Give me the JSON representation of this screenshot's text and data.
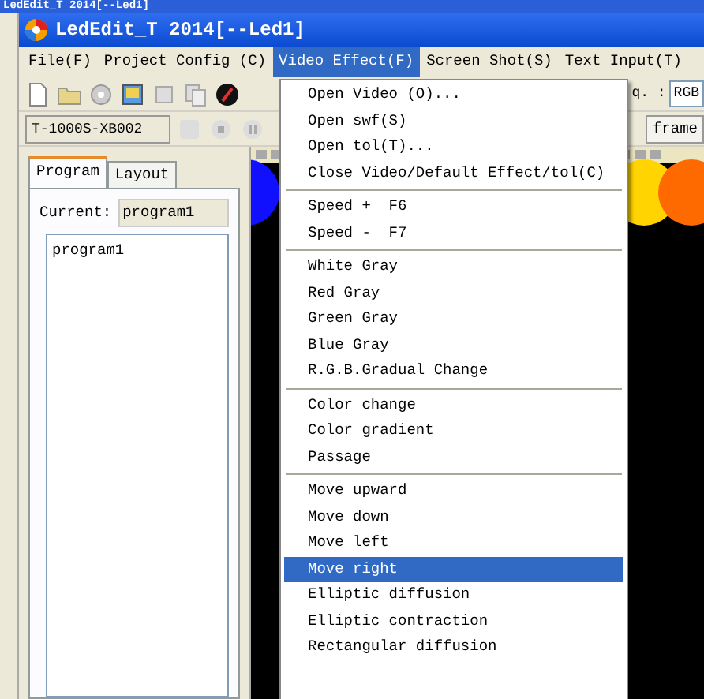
{
  "back_window": {
    "title": "LedEdit_T 2014[--Led1]"
  },
  "window": {
    "title": "LedEdit_T 2014[--Led1]"
  },
  "menu_bar": [
    {
      "label": "File(F)",
      "selected": false
    },
    {
      "label": "Project Config (C)",
      "selected": false
    },
    {
      "label": "Video Effect(F)",
      "selected": true
    },
    {
      "label": "Screen Shot(S)",
      "selected": false
    },
    {
      "label": "Text Input(T)",
      "selected": false
    }
  ],
  "toolbar": {
    "color_label": "q. :",
    "color_value": "RGB",
    "device": "T-1000S-XB002",
    "frame_button": "frame"
  },
  "left_panel": {
    "tabs": [
      {
        "label": "Program",
        "selected": true
      },
      {
        "label": "Layout",
        "selected": false
      }
    ],
    "current_label": "Current:",
    "current_value": "program1",
    "programs": [
      {
        "label": "program1",
        "selected": false
      }
    ]
  },
  "canvas": {
    "circles": [
      {
        "color": "#1010ff"
      },
      {
        "color": "#ffd400"
      },
      {
        "color": "#ff6a00"
      }
    ]
  },
  "dropdown": {
    "groups": [
      [
        {
          "label": "Open Video (O)...",
          "selected": false
        },
        {
          "label": "Open swf(S)",
          "selected": false
        },
        {
          "label": "Open tol(T)...",
          "selected": false
        },
        {
          "label": "Close Video/Default Effect/tol(C)",
          "selected": false
        }
      ],
      [
        {
          "label": "Speed +  F6",
          "selected": false
        },
        {
          "label": "Speed -  F7",
          "selected": false
        }
      ],
      [
        {
          "label": "White Gray",
          "selected": false
        },
        {
          "label": "Red Gray",
          "selected": false
        },
        {
          "label": "Green Gray",
          "selected": false
        },
        {
          "label": "Blue Gray",
          "selected": false
        },
        {
          "label": "R.G.B.Gradual Change",
          "selected": false
        }
      ],
      [
        {
          "label": "Color change",
          "selected": false
        },
        {
          "label": "Color gradient",
          "selected": false
        },
        {
          "label": "Passage",
          "selected": false
        }
      ],
      [
        {
          "label": "Move upward",
          "selected": false
        },
        {
          "label": "Move down",
          "selected": false
        },
        {
          "label": "Move left",
          "selected": false
        },
        {
          "label": "Move right",
          "selected": true
        },
        {
          "label": "Elliptic diffusion",
          "selected": false
        },
        {
          "label": "Elliptic contraction",
          "selected": false
        },
        {
          "label": "Rectangular diffusion",
          "selected": false
        }
      ]
    ]
  }
}
